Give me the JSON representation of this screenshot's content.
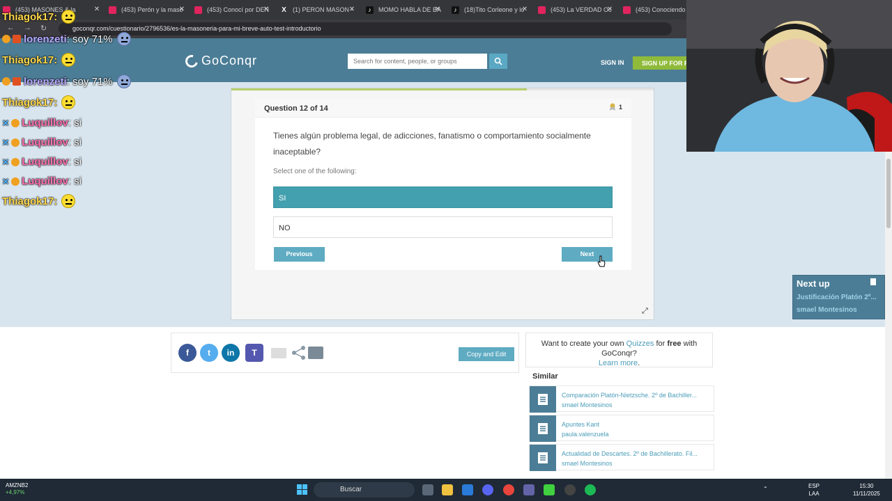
{
  "browser": {
    "tabs": [
      {
        "title": "(453) MASONES & la",
        "icon": "youtube-icon"
      },
      {
        "title": "(453) Perón y la maso",
        "icon": "youtube-icon"
      },
      {
        "title": "(453) Conocí por DEN",
        "icon": "youtube-icon"
      },
      {
        "title": "(1) PERON MASON -",
        "icon": "x-icon"
      },
      {
        "title": "MOMO HABLA DE BA",
        "icon": "tiktok-icon"
      },
      {
        "title": "(18)Tito Corleone y lo",
        "icon": "tiktok-icon"
      },
      {
        "title": "(453) La VERDAD Oc",
        "icon": "youtube-icon"
      },
      {
        "title": "(453) Conociendo el",
        "icon": "youtube-icon"
      }
    ],
    "url": "goconqr.com/cuestionario/2796536/es-la-masoneria-para-mi-breve-auto-test-introductorio"
  },
  "header": {
    "logo_text": "GoConqr",
    "search_placeholder": "Search for content, people, or groups",
    "sign_in": "SIGN IN",
    "sign_up": "SIGN UP FOR FREE"
  },
  "quiz": {
    "question_label": "Question 12 of 14",
    "progress": 0.7,
    "likes": "1",
    "question": "Tienes algún problema legal, de adicciones, fanatismo o comportamiento socialmente inaceptable?",
    "instruction": "Select one of the following:",
    "answers": [
      {
        "label": "SI",
        "selected": true
      },
      {
        "label": "NO",
        "selected": false
      }
    ],
    "previous": "Previous",
    "next": "Next"
  },
  "next_up": {
    "title": "Next up",
    "item": "Justificación Platón 2º...",
    "author": "smael Montesinos"
  },
  "share": {
    "copy_edit": "Copy and Edit",
    "create_pre": "Want to create your own ",
    "create_link": "Quizzes",
    "create_mid": " for ",
    "create_bold": "free",
    "create_post": " with GoConqr?",
    "learn_more": "Learn more"
  },
  "similar": {
    "heading": "Similar",
    "items": [
      {
        "title": "Comparación Platón-Nietzsche. 2º de Bachiller...",
        "author": "smael Montesinos"
      },
      {
        "title": "Apuntes Kant",
        "author": "paula.valenzuela"
      },
      {
        "title": "Actualidad de Descartes. 2º de Bachillerato. Fil...",
        "author": "smael Montesinos"
      }
    ]
  },
  "chat": [
    {
      "user": "Thiagok17",
      "color": "#ffd84a",
      "message": "",
      "emote": true
    },
    {
      "user": "lorenzeti",
      "color": "#b9a7ff",
      "message": "soy 71%",
      "emote": false
    },
    {
      "user": "Thiagok17",
      "color": "#ffd84a",
      "message": "",
      "emote": true
    },
    {
      "user": "lorenzeti",
      "color": "#b9a7ff",
      "message": "soy 71%",
      "emote": false
    },
    {
      "user": "Thiagok17",
      "color": "#ffd84a",
      "message": "",
      "emote": true
    },
    {
      "user": "Luquillov",
      "color": "#ff6fb0",
      "message": "si",
      "emote": false
    },
    {
      "user": "Luquillov",
      "color": "#ff6fb0",
      "message": "si",
      "emote": false
    },
    {
      "user": "Luquillov",
      "color": "#ff6fb0",
      "message": "si",
      "emote": false
    },
    {
      "user": "Luquillov",
      "color": "#ff6fb0",
      "message": "si",
      "emote": false
    },
    {
      "user": "Thiagok17",
      "color": "#ffd84a",
      "message": "",
      "emote": true
    }
  ],
  "taskbar": {
    "stock_name": "AMZNB2",
    "stock_change": "+4,97%",
    "search": "Buscar",
    "lang": "ESP",
    "region": "LAA",
    "time": "15:30",
    "date": "11/11/2025"
  }
}
